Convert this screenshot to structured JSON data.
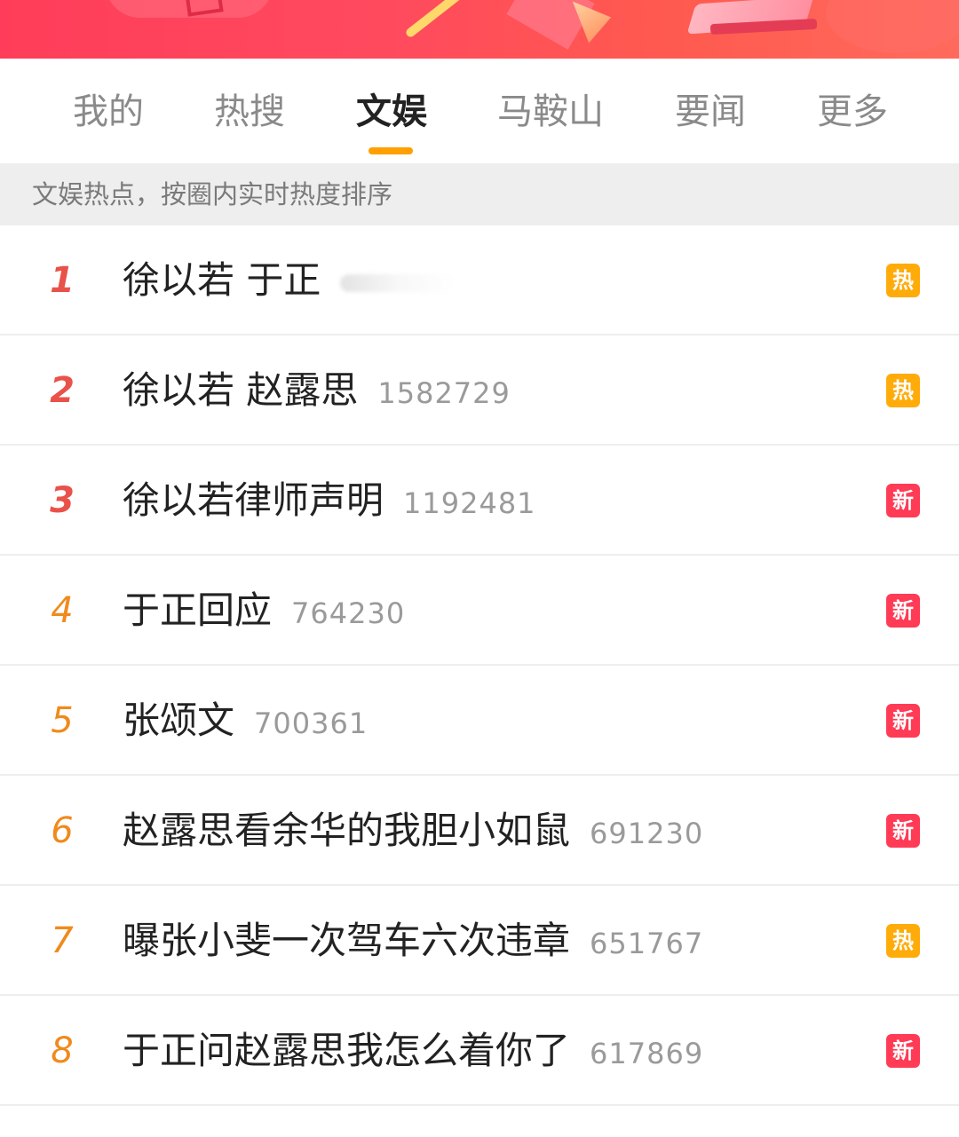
{
  "tabs": [
    {
      "label": "我的",
      "active": false
    },
    {
      "label": "热搜",
      "active": false
    },
    {
      "label": "文娱",
      "active": true
    },
    {
      "label": "马鞍山",
      "active": false
    },
    {
      "label": "要闻",
      "active": false
    },
    {
      "label": "更多",
      "active": false
    }
  ],
  "subheader": "文娱热点，按圈内实时热度排序",
  "colors": {
    "accent": "#ff9f00",
    "hot_badge": "#ffab0a",
    "new_badge": "#ff3b56",
    "rank_top": "#e8524a",
    "rank_mid": "#f08a1c"
  },
  "items": [
    {
      "rank": "1",
      "title": "徐以若 于正",
      "count": "",
      "badge": "热",
      "badge_type": "hot"
    },
    {
      "rank": "2",
      "title": "徐以若 赵露思",
      "count": "1582729",
      "badge": "热",
      "badge_type": "hot"
    },
    {
      "rank": "3",
      "title": "徐以若律师声明",
      "count": "1192481",
      "badge": "新",
      "badge_type": "new"
    },
    {
      "rank": "4",
      "title": "于正回应",
      "count": "764230",
      "badge": "新",
      "badge_type": "new"
    },
    {
      "rank": "5",
      "title": "张颂文",
      "count": "700361",
      "badge": "新",
      "badge_type": "new"
    },
    {
      "rank": "6",
      "title": "赵露思看余华的我胆小如鼠",
      "count": "691230",
      "badge": "新",
      "badge_type": "new"
    },
    {
      "rank": "7",
      "title": "曝张小斐一次驾车六次违章",
      "count": "651767",
      "badge": "热",
      "badge_type": "hot"
    },
    {
      "rank": "8",
      "title": "于正问赵露思我怎么着你了",
      "count": "617869",
      "badge": "新",
      "badge_type": "new"
    }
  ]
}
